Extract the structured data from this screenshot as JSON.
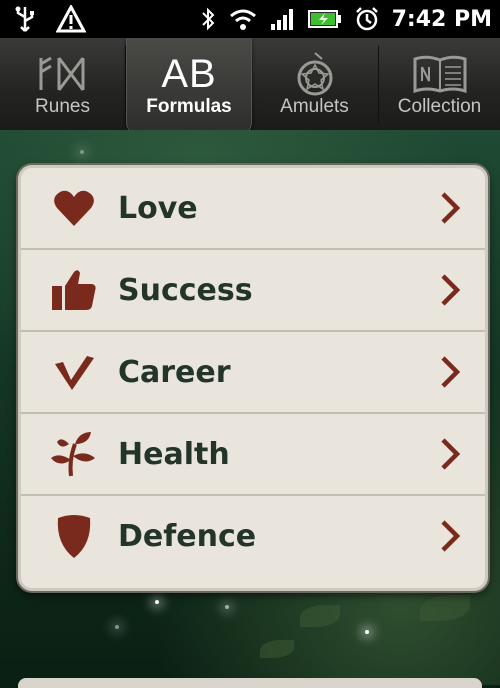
{
  "status_bar": {
    "time": "7:42 PM",
    "icons": [
      "usb-icon",
      "warning-icon",
      "bluetooth-icon",
      "wifi-icon",
      "signal-icon",
      "battery-icon",
      "alarm-icon"
    ]
  },
  "tabs": [
    {
      "label": "Runes",
      "icon": "runes-icon",
      "active": false
    },
    {
      "label": "Formulas",
      "icon": "ab-icon",
      "glyph": "AB",
      "active": true
    },
    {
      "label": "Amulets",
      "icon": "amulet-icon",
      "active": false
    },
    {
      "label": "Collection",
      "icon": "book-icon",
      "active": false
    }
  ],
  "formulas": [
    {
      "label": "Love",
      "icon": "heart-icon"
    },
    {
      "label": "Success",
      "icon": "thumbs-up-icon"
    },
    {
      "label": "Career",
      "icon": "checkmark-icon"
    },
    {
      "label": "Health",
      "icon": "sprout-icon"
    },
    {
      "label": "Defence",
      "icon": "shield-icon"
    }
  ],
  "colors": {
    "icon_accent": "#7a2a1c",
    "label_text": "#233528",
    "card_bg": "#e9e5dd"
  }
}
